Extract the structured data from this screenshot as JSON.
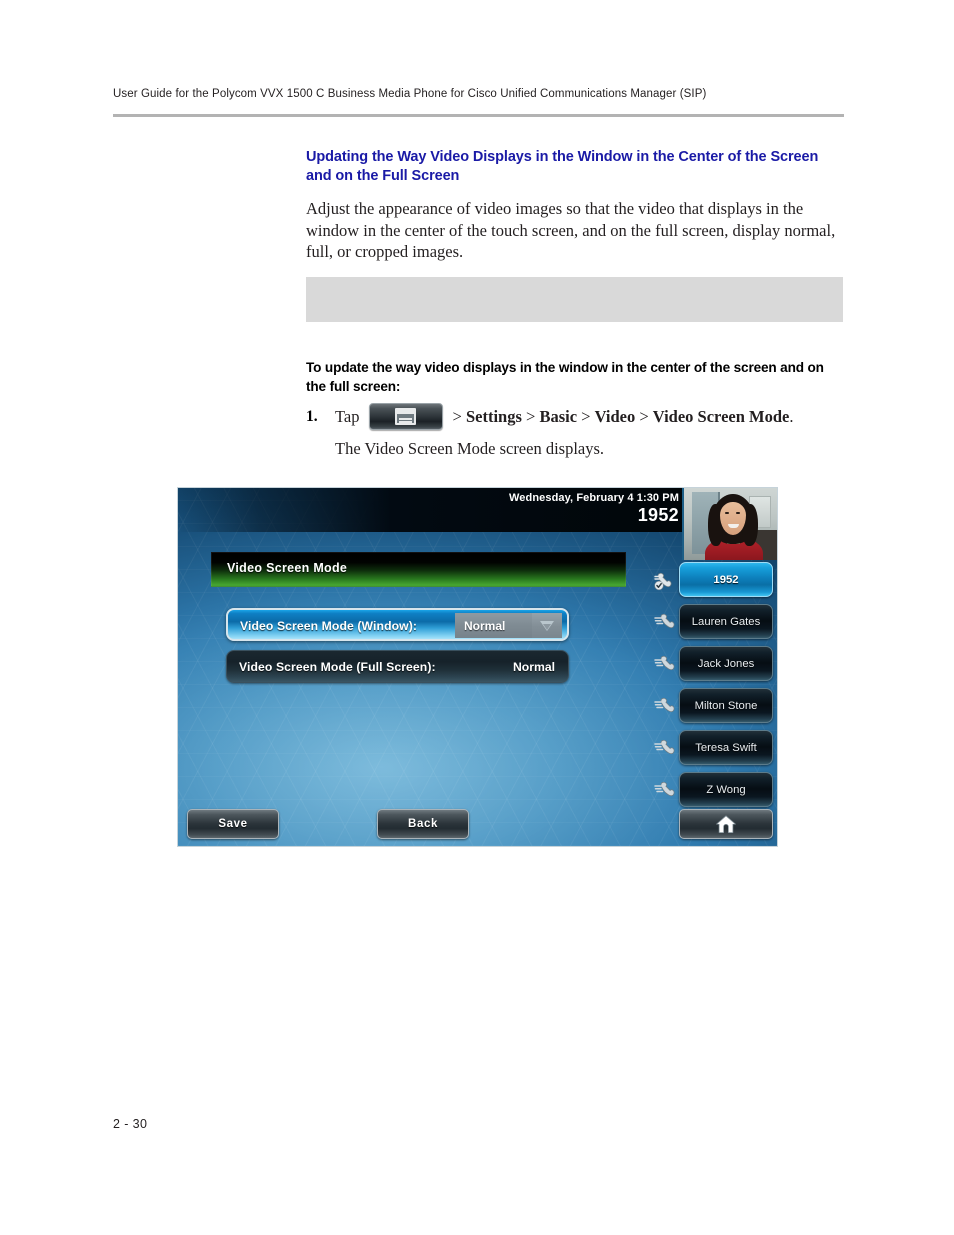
{
  "header": {
    "running_head": "User Guide for the Polycom VVX 1500 C Business Media Phone for Cisco Unified Communications Manager (SIP)"
  },
  "content": {
    "heading": "Updating the Way Video Displays in the Window in the Center of the Screen and on the Full Screen",
    "paragraph": "Adjust the appearance of video images so that the video that displays in the window in the center of the touch screen, and on the full screen, display normal, full, or cropped images.",
    "note_box_text": "",
    "instruction": "To update the way video displays in the window in the center of the screen and on the full screen:",
    "step": {
      "number": "1.",
      "tap_word": "Tap",
      "menu_icon": "menu-key-icon",
      "breadcrumb": "> Settings > Basic > Video > Video Screen Mode.",
      "breadcrumb_parts": [
        "> ",
        "Settings",
        " > ",
        "Basic",
        " > ",
        "Video",
        " > ",
        "Video Screen Mode",
        "."
      ],
      "result": "The Video Screen Mode screen displays."
    }
  },
  "phone": {
    "status": {
      "date_time": "Wednesday, February 4  1:30 PM",
      "extension": "1952"
    },
    "video_thumbnail": "self-view-video-icon",
    "screen_title": "Video Screen Mode",
    "settings": [
      {
        "label": "Video Screen Mode (Window):",
        "value": "Normal",
        "selected": true,
        "has_dropdown": true
      },
      {
        "label": "Video Screen Mode (Full Screen):",
        "value": "Normal",
        "selected": false,
        "has_dropdown": false
      }
    ],
    "line_keys": [
      {
        "label": "1952",
        "active": true
      },
      {
        "label": "Lauren Gates",
        "active": false
      },
      {
        "label": "Jack Jones",
        "active": false
      },
      {
        "label": "Milton Stone",
        "active": false
      },
      {
        "label": "Teresa Swift",
        "active": false
      },
      {
        "label": "Z Wong",
        "active": false
      }
    ],
    "softkeys": {
      "save": "Save",
      "back": "Back",
      "home_icon": "home-icon"
    },
    "colors": {
      "screen_blue": "#2d78ad",
      "title_green": "#47a832",
      "selected_blue": "#0e7fc4",
      "heading_blue": "#1a1aa6",
      "note_gray": "#d9d9d9"
    }
  },
  "footer": {
    "page_number": "2 - 30"
  }
}
